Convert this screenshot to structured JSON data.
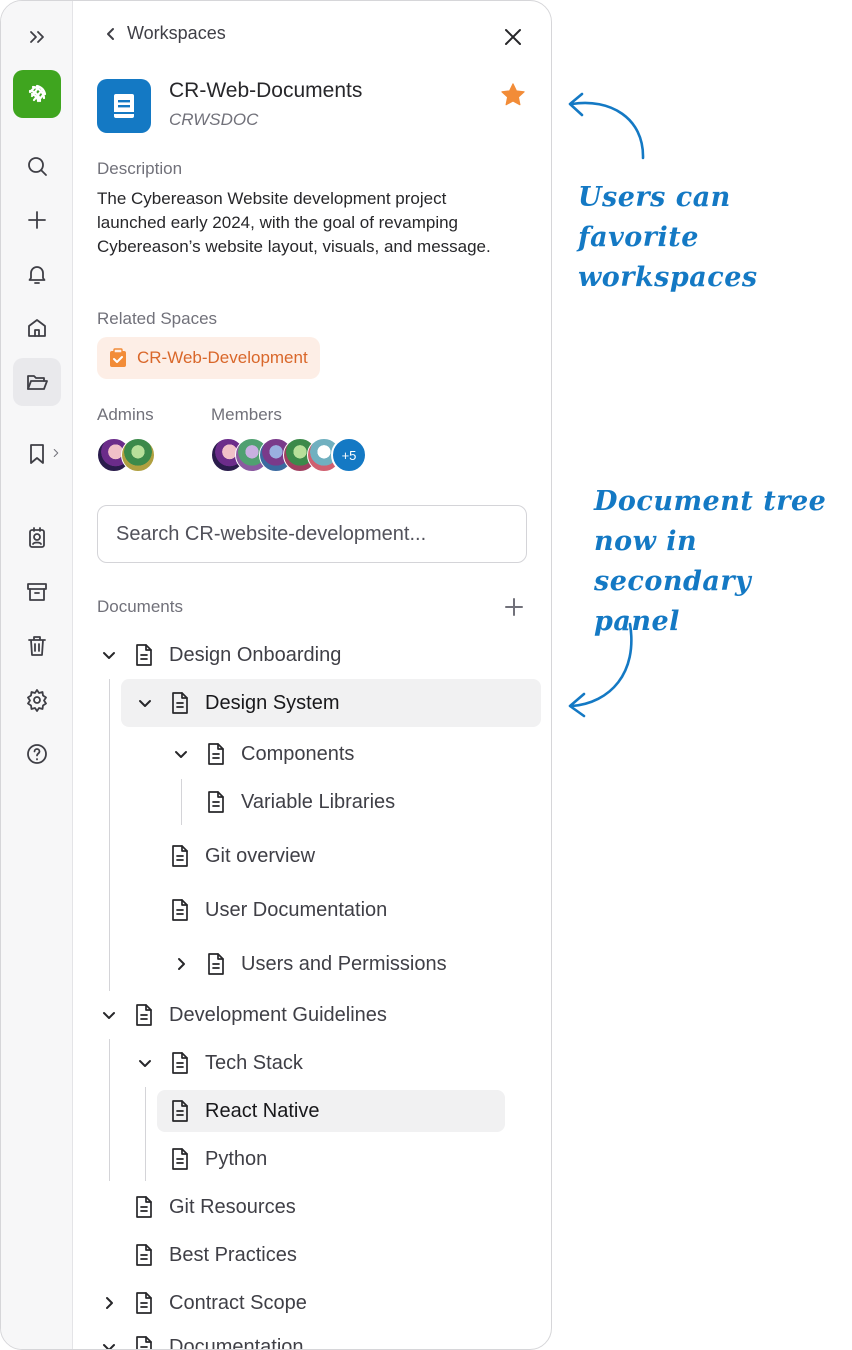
{
  "rail": {
    "icons": [
      "expand-icon",
      "app-logo",
      "search-icon",
      "plus-icon",
      "bell-icon",
      "home-icon",
      "folder-open-icon",
      "bookmark-icon",
      "contact-icon",
      "archive-icon",
      "trash-icon",
      "settings-icon",
      "help-icon"
    ]
  },
  "header": {
    "back_label": "Workspaces"
  },
  "workspace": {
    "title": "CR-Web-Documents",
    "code": "CRWSDOC",
    "favorited": true,
    "icon_color": "#1479c4",
    "star_color": "#f28c38"
  },
  "description": {
    "label": "Description",
    "text": "The Cybereason Website development project launched early 2024, with the goal of revamping Cybereason’s website layout, visuals, and message."
  },
  "related": {
    "label": "Related Spaces",
    "chip": "CR-Web-Development",
    "chip_color": "#d9672a"
  },
  "people": {
    "admins_label": "Admins",
    "members_label": "Members",
    "admins_count": 2,
    "members_more": "+5"
  },
  "search": {
    "placeholder": "Search CR-website-development..."
  },
  "documents": {
    "label": "Documents",
    "tree": [
      "Design Onboarding",
      "Design System",
      "Components",
      "Variable Libraries",
      "Git overview",
      "User Documentation",
      "Users and Permissions",
      "Development Guidelines",
      "Tech Stack",
      "React Native",
      "Python",
      "Git Resources",
      "Best Practices",
      "Contract Scope",
      "Documentation"
    ]
  },
  "annotations": {
    "favorite_line1": "Users can favorite",
    "favorite_line2": "workspaces",
    "tree_line1": "Document tree",
    "tree_line2": "now in secondary",
    "tree_line3": "panel",
    "color": "#1479c4"
  }
}
